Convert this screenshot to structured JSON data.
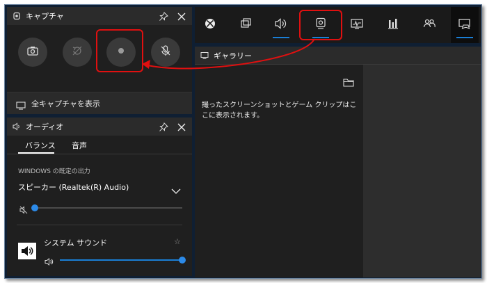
{
  "capture": {
    "title": "キャプチャ",
    "show_all_label": "全キャプチャを表示",
    "buttons": [
      "camera-icon",
      "record-last-icon",
      "record-icon",
      "mic-off-icon"
    ]
  },
  "audio": {
    "title": "オーディオ",
    "tabs": [
      "バランス",
      "音声"
    ],
    "output_label": "WINDOWS の既定の出力",
    "device": "スピーカー (Realtek(R) Audio)",
    "device_volume": 0.0,
    "app_name": "システム サウンド",
    "app_volume": 1.0
  },
  "toolbar": {
    "items": [
      "xbox-icon",
      "widget-menu-icon",
      "audio-icon",
      "capture-icon",
      "performance-icon",
      "resources-icon",
      "social-icon",
      "controller-icon"
    ],
    "active": "controller-icon"
  },
  "gallery": {
    "title": "ギャラリー",
    "empty_text": "撮ったスクリーンショットとゲーム クリップはここに表示されます。"
  },
  "colors": {
    "accent": "#1a7fd6",
    "annotation": "#e01010",
    "panel": "#1f1f1f",
    "backdrop": "#0f1f33"
  }
}
